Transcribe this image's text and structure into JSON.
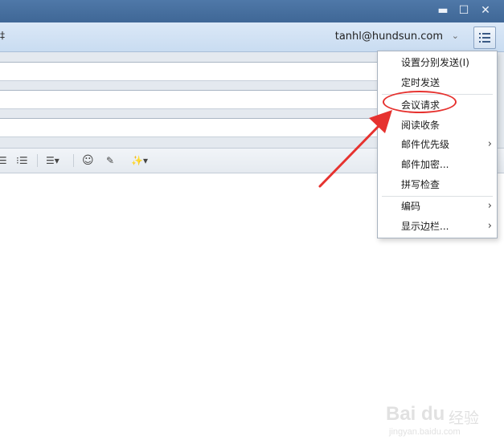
{
  "window": {
    "minimize_glyph": "▬",
    "maximize_glyph": "☐",
    "close_glyph": "✕"
  },
  "header": {
    "left_glyph": "‡",
    "account": "tanhl@hundsun.com",
    "account_caret": "⌄"
  },
  "toolbar": {
    "bullet_list": "⁝☰",
    "numbered_list": "⁝☰",
    "align": "☰▾",
    "emoji": "☺",
    "clear_format": "✎",
    "magic": "✨▾"
  },
  "menu": {
    "items": [
      {
        "label": "设置分别发送(I)",
        "submenu": false
      },
      {
        "label": "定时发送",
        "submenu": false
      },
      {
        "label": "会议请求",
        "submenu": false
      },
      {
        "label": "阅读收条",
        "submenu": false
      },
      {
        "label": "邮件优先级",
        "submenu": true
      },
      {
        "label": "邮件加密...",
        "submenu": false
      },
      {
        "label": "拼写检查",
        "submenu": false
      },
      {
        "label": "编码",
        "submenu": true
      },
      {
        "label": "显示边栏...",
        "submenu": true
      }
    ],
    "submenu_glyph": "›"
  },
  "annotation": {
    "color": "#e6322f",
    "highlighted_item": "会议请求"
  },
  "watermark": {
    "brand": "Bai du",
    "suffix": "经验",
    "url": "jingyan.baidu.com"
  }
}
